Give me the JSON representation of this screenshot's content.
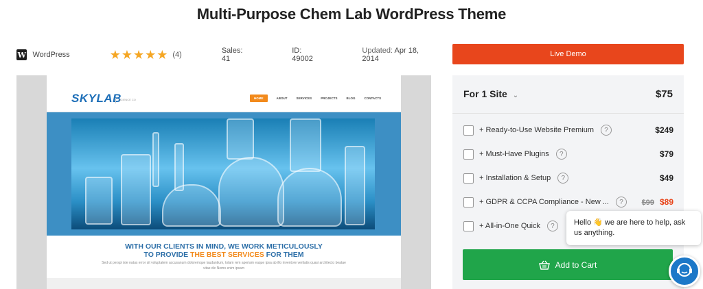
{
  "product": {
    "title": "Multi-Purpose Chem Lab WordPress Theme",
    "platform": "WordPress",
    "wp_logo_letter": "W",
    "rating_stars": 5,
    "rating_count": "(4)",
    "sales": "Sales: 41",
    "id": "ID: 49002",
    "updated_label": "Updated:",
    "updated_date": "Apr 18, 2014"
  },
  "preview": {
    "logo": "SKYLAB",
    "logo_sub": "SCIENCE CO",
    "nav": [
      "HOME",
      "ABOUT",
      "SERVICES",
      "PROJECTS",
      "BLOG",
      "CONTACTS"
    ],
    "tagline_line1": "WITH OUR CLIENTS IN MIND, WE WORK METICULOUSLY",
    "tagline_line2_prefix": "TO PROVIDE ",
    "tagline_line2_accent": "THE BEST SERVICES",
    "tagline_line2_suffix": " FOR THEM",
    "lorem": "Sed ut perspi iste natus error sit voluptatem accusanum doloremque laudantium, totam rem aperiam eaque ipsa ab illo inventore veritatis quasi architecto beatae vitae dic Nemo enim ipsam"
  },
  "actions": {
    "live_demo": "Live Demo",
    "add_to_cart": "Add to Cart"
  },
  "pricing": {
    "license_label": "For 1 Site",
    "license_price": "$75",
    "addons": [
      {
        "label": "+ Ready-to-Use Website Premium",
        "price": "$249"
      },
      {
        "label": "+ Must-Have Plugins",
        "price": "$79"
      },
      {
        "label": "+ Installation & Setup",
        "price": "$49"
      },
      {
        "label": "+ GDPR & CCPA Compliance - New ...",
        "old_price": "$99",
        "price": "$89"
      },
      {
        "label": "+ All-in-One Quick"
      }
    ]
  },
  "chat": {
    "message_part1": "Hello ",
    "message_part2": " we are here to help, ask us anything."
  },
  "colors": {
    "accent_orange": "#e8461c",
    "add_to_cart_green": "#20a54a",
    "star_yellow": "#f5a623",
    "chat_blue": "#1c78c8"
  }
}
